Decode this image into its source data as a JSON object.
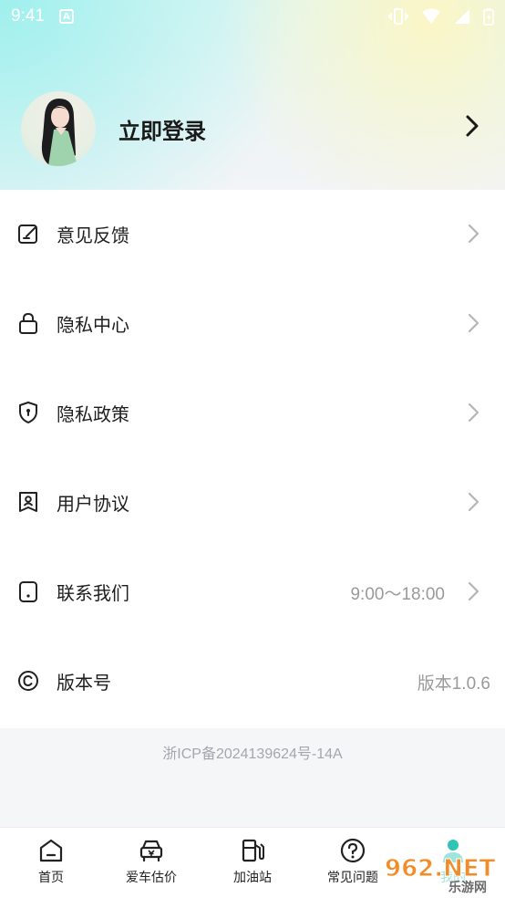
{
  "status_bar": {
    "time": "9:41",
    "notification_letter": "A"
  },
  "profile": {
    "login_label": "立即登录"
  },
  "menu": {
    "items": [
      {
        "label": "意见反馈",
        "value": "",
        "icon": "feedback-edit-icon"
      },
      {
        "label": "隐私中心",
        "value": "",
        "icon": "lock-icon"
      },
      {
        "label": "隐私政策",
        "value": "",
        "icon": "shield-icon"
      },
      {
        "label": "用户协议",
        "value": "",
        "icon": "user-agreement-icon"
      },
      {
        "label": "联系我们",
        "value": "9:00～18:00",
        "icon": "phone-icon"
      },
      {
        "label": "版本号",
        "value": "版本1.0.6",
        "icon": "copyright-icon"
      }
    ]
  },
  "footer": {
    "icp": "浙ICP备2024139624号-14A"
  },
  "tabbar": {
    "tabs": [
      {
        "label": "首页",
        "icon": "home-icon"
      },
      {
        "label": "爱车估价",
        "icon": "car-valuation-icon"
      },
      {
        "label": "加油站",
        "icon": "gas-station-icon"
      },
      {
        "label": "常见问题",
        "icon": "question-icon"
      },
      {
        "label": "我的",
        "icon": "profile-icon"
      }
    ]
  },
  "watermark": {
    "text": "962.NET",
    "subtext": "乐游网"
  },
  "colors": {
    "accent": "#2ec4b6",
    "muted_text": "#9a9a9a",
    "chevron": "#b5b5b5"
  }
}
